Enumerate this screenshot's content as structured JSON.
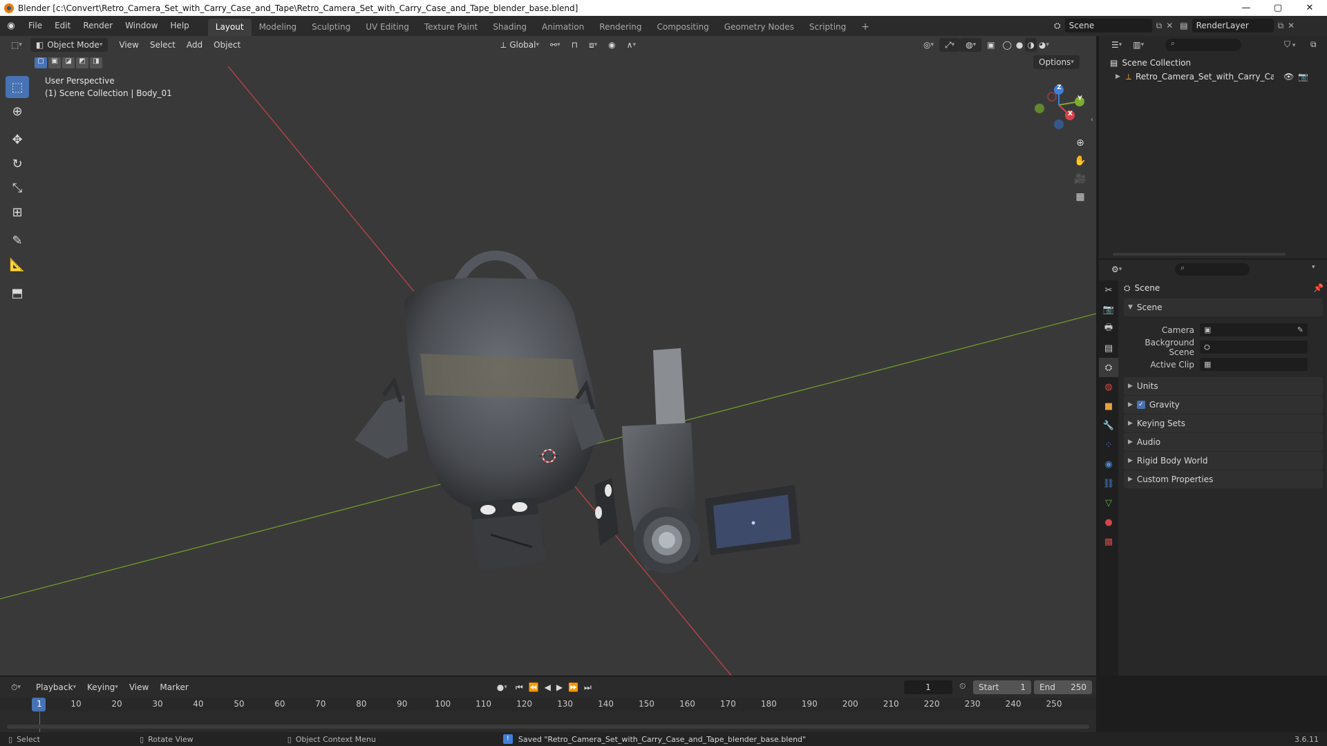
{
  "title_bar": {
    "title": "Blender [c:\\Convert\\Retro_Camera_Set_with_Carry_Case_and_Tape\\Retro_Camera_Set_with_Carry_Case_and_Tape_blender_base.blend]",
    "minimize": "—",
    "maximize": "▢",
    "close": "✕"
  },
  "menu": {
    "items": [
      "File",
      "Edit",
      "Render",
      "Window",
      "Help"
    ],
    "workspaces": [
      "Layout",
      "Modeling",
      "Sculpting",
      "UV Editing",
      "Texture Paint",
      "Shading",
      "Animation",
      "Rendering",
      "Compositing",
      "Geometry Nodes",
      "Scripting"
    ],
    "active_workspace": "Layout",
    "add_tab": "+",
    "scene": "Scene",
    "view_layer": "RenderLayer"
  },
  "viewport": {
    "mode": "Object Mode",
    "menus": [
      "View",
      "Select",
      "Add",
      "Object"
    ],
    "transform_orientation": "Global",
    "options_label": "Options",
    "perspective_label": "User Perspective",
    "collection_label": "(1) Scene Collection | Body_01",
    "gizmo": {
      "x": "X",
      "y": "Y",
      "z": "Z"
    }
  },
  "outliner": {
    "root": "Scene Collection",
    "items": [
      {
        "label": "Retro_Camera_Set_with_Carry_Case_an"
      }
    ]
  },
  "properties": {
    "header_title": "Scene",
    "panels": {
      "scene": {
        "title": "Scene",
        "fields": [
          {
            "label": "Camera",
            "value": ""
          },
          {
            "label": "Background Scene",
            "value": ""
          },
          {
            "label": "Active Clip",
            "value": ""
          }
        ]
      }
    },
    "collapsed_panels": [
      "Units",
      "Gravity",
      "Keying Sets",
      "Audio",
      "Rigid Body World",
      "Custom Properties"
    ],
    "gravity_checked": true
  },
  "timeline": {
    "menus": [
      "Playback",
      "Keying",
      "View",
      "Marker"
    ],
    "current_frame": "1",
    "start_label": "Start",
    "start_value": "1",
    "end_label": "End",
    "end_value": "250",
    "ticks": [
      "1",
      "10",
      "20",
      "30",
      "40",
      "50",
      "60",
      "70",
      "80",
      "90",
      "100",
      "110",
      "120",
      "130",
      "140",
      "150",
      "160",
      "170",
      "180",
      "190",
      "200",
      "210",
      "220",
      "230",
      "240",
      "250"
    ]
  },
  "status_bar": {
    "select": "Select",
    "rotate": "Rotate View",
    "context_menu": "Object Context Menu",
    "message": "Saved \"Retro_Camera_Set_with_Carry_Case_and_Tape_blender_base.blend\"",
    "version": "3.6.11"
  },
  "colors": {
    "accent": "#4772b3",
    "x_axis": "#d8434b",
    "y_axis": "#7fab32",
    "z_axis": "#3f7fdc"
  }
}
